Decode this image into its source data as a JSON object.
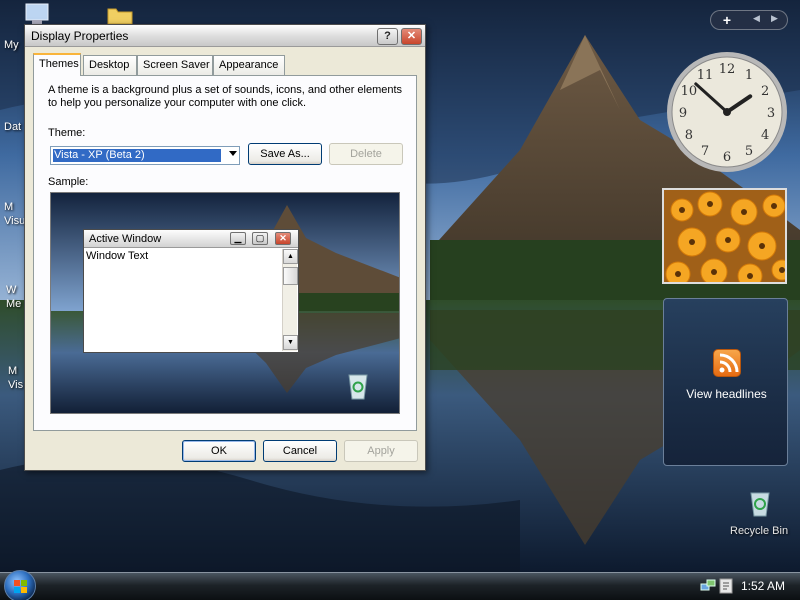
{
  "desktop": {
    "icons": [
      {
        "label": "My"
      },
      {
        "label": "Dat"
      },
      {
        "label": "M\nVisu"
      },
      {
        "label": "W\nMe"
      },
      {
        "label": "M\nVis"
      }
    ],
    "recycle_bin_label": "Recycle Bin"
  },
  "dialog": {
    "title": "Display Properties",
    "help_button": "?",
    "close_button": "✕",
    "tabs": [
      "Themes",
      "Desktop",
      "Screen Saver",
      "Appearance"
    ],
    "active_tab": "Themes",
    "description": "A theme is a background plus a set of sounds, icons, and other elements to help you personalize your computer with one click.",
    "theme_label": "Theme:",
    "theme_value": "Vista - XP (Beta 2)",
    "save_as_label": "Save As...",
    "delete_label": "Delete",
    "sample_label": "Sample:",
    "sample_window": {
      "title": "Active Window",
      "text": "Window Text"
    },
    "ok_label": "OK",
    "cancel_label": "Cancel",
    "apply_label": "Apply"
  },
  "sidebar": {
    "add_gadget": "+",
    "feeds_label": "View headlines",
    "clock": {
      "hours": 1,
      "minutes": 52,
      "numerals": [
        "12",
        "1",
        "2",
        "3",
        "4",
        "5",
        "6",
        "7",
        "8",
        "9",
        "10",
        "11"
      ]
    }
  },
  "taskbar": {
    "time": "1:52 AM"
  },
  "colors": {
    "selection": "#316ac5",
    "title_active": "#ece9d8",
    "tab_highlight": "#f9b43b",
    "taskbar": "#1d2328"
  }
}
